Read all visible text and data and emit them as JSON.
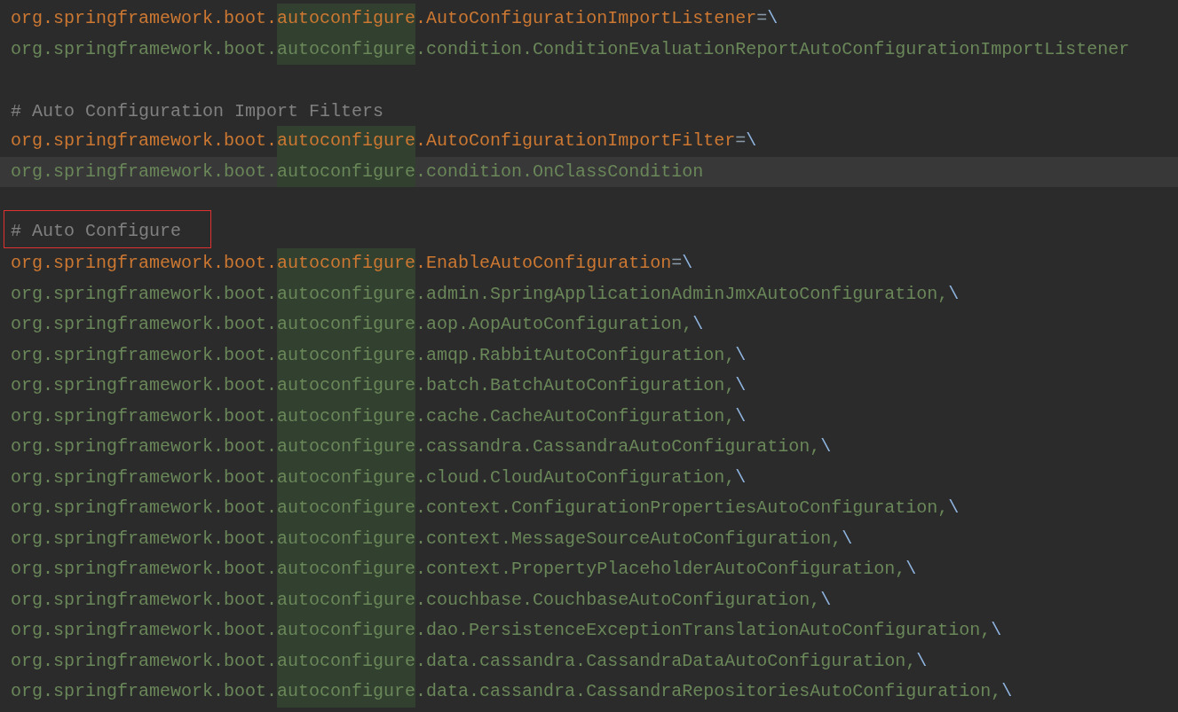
{
  "lines": [
    {
      "kind": "key",
      "current": false,
      "prefix": "org.springframework.boot.",
      "match": "autoconfigure",
      "rest": ".AutoConfigurationImportListener",
      "operator": "=",
      "continuation": "\\"
    },
    {
      "kind": "value",
      "current": false,
      "prefix": "org.springframework.boot.",
      "match": "autoconfigure",
      "rest": ".condition.ConditionEvaluationReportAutoConfigurationImportListener"
    },
    {
      "kind": "blank",
      "current": false
    },
    {
      "kind": "comment",
      "current": false,
      "boxed": false,
      "text": "# Auto Configuration Import Filters"
    },
    {
      "kind": "key",
      "current": false,
      "prefix": "org.springframework.boot.",
      "match": "autoconfigure",
      "rest": ".AutoConfigurationImportFilter",
      "operator": "=",
      "continuation": "\\"
    },
    {
      "kind": "value",
      "current": true,
      "prefix": "org.springframework.boot.",
      "match": "autoconfigure",
      "rest": ".condition.OnClassCondition"
    },
    {
      "kind": "blank",
      "current": false
    },
    {
      "kind": "comment",
      "current": false,
      "boxed": true,
      "text": "# Auto Configure"
    },
    {
      "kind": "key",
      "current": false,
      "prefix": "org.springframework.boot.",
      "match": "autoconfigure",
      "rest": ".EnableAutoConfiguration",
      "operator": "=",
      "continuation": "\\"
    },
    {
      "kind": "value",
      "current": false,
      "prefix": "org.springframework.boot.",
      "match": "autoconfigure",
      "rest": ".admin.SpringApplicationAdminJmxAutoConfiguration,",
      "continuation": "\\"
    },
    {
      "kind": "value",
      "current": false,
      "prefix": "org.springframework.boot.",
      "match": "autoconfigure",
      "rest": ".aop.AopAutoConfiguration,",
      "continuation": "\\"
    },
    {
      "kind": "value",
      "current": false,
      "prefix": "org.springframework.boot.",
      "match": "autoconfigure",
      "rest": ".amqp.RabbitAutoConfiguration,",
      "continuation": "\\"
    },
    {
      "kind": "value",
      "current": false,
      "prefix": "org.springframework.boot.",
      "match": "autoconfigure",
      "rest": ".batch.BatchAutoConfiguration,",
      "continuation": "\\"
    },
    {
      "kind": "value",
      "current": false,
      "prefix": "org.springframework.boot.",
      "match": "autoconfigure",
      "rest": ".cache.CacheAutoConfiguration,",
      "continuation": "\\"
    },
    {
      "kind": "value",
      "current": false,
      "prefix": "org.springframework.boot.",
      "match": "autoconfigure",
      "rest": ".cassandra.CassandraAutoConfiguration,",
      "continuation": "\\"
    },
    {
      "kind": "value",
      "current": false,
      "prefix": "org.springframework.boot.",
      "match": "autoconfigure",
      "rest": ".cloud.CloudAutoConfiguration,",
      "continuation": "\\"
    },
    {
      "kind": "value",
      "current": false,
      "prefix": "org.springframework.boot.",
      "match": "autoconfigure",
      "rest": ".context.ConfigurationPropertiesAutoConfiguration,",
      "continuation": "\\"
    },
    {
      "kind": "value",
      "current": false,
      "prefix": "org.springframework.boot.",
      "match": "autoconfigure",
      "rest": ".context.MessageSourceAutoConfiguration,",
      "continuation": "\\"
    },
    {
      "kind": "value",
      "current": false,
      "prefix": "org.springframework.boot.",
      "match": "autoconfigure",
      "rest": ".context.PropertyPlaceholderAutoConfiguration,",
      "continuation": "\\"
    },
    {
      "kind": "value",
      "current": false,
      "prefix": "org.springframework.boot.",
      "match": "autoconfigure",
      "rest": ".couchbase.CouchbaseAutoConfiguration,",
      "continuation": "\\"
    },
    {
      "kind": "value",
      "current": false,
      "prefix": "org.springframework.boot.",
      "match": "autoconfigure",
      "rest": ".dao.PersistenceExceptionTranslationAutoConfiguration,",
      "continuation": "\\"
    },
    {
      "kind": "value",
      "current": false,
      "prefix": "org.springframework.boot.",
      "match": "autoconfigure",
      "rest": ".data.cassandra.CassandraDataAutoConfiguration,",
      "continuation": "\\"
    },
    {
      "kind": "value",
      "current": false,
      "prefix": "org.springframework.boot.",
      "match": "autoconfigure",
      "rest": ".data.cassandra.CassandraRepositoriesAutoConfiguration,",
      "continuation": "\\"
    }
  ]
}
